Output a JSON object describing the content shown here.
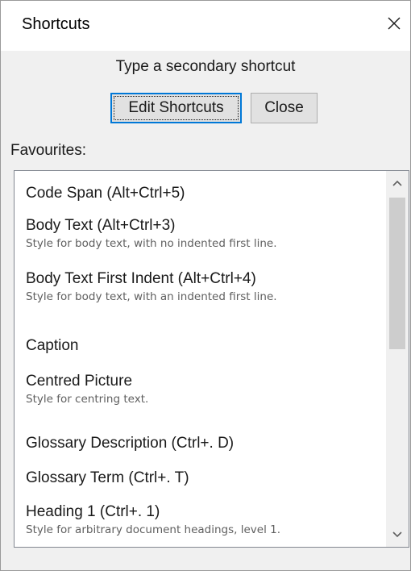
{
  "window": {
    "title": "Shortcuts",
    "close_icon": "close-icon"
  },
  "subtitle": "Type a secondary shortcut",
  "buttons": {
    "edit_shortcuts": "Edit Shortcuts",
    "close": "Close"
  },
  "favourites_label": "Favourites:",
  "favourites": [
    {
      "title": "Code Span (Alt+Ctrl+5)",
      "description": ""
    },
    {
      "title": "Body Text (Alt+Ctrl+3)",
      "description": "Style for body text, with no indented first line."
    },
    {
      "title": "Body Text First Indent (Alt+Ctrl+4)",
      "description": "Style for body text, with an indented first line."
    },
    {
      "title": "Caption",
      "description": ""
    },
    {
      "title": "Centred Picture",
      "description": "Style for centring text."
    },
    {
      "title": "Glossary Description (Ctrl+. D)",
      "description": ""
    },
    {
      "title": "Glossary Term (Ctrl+. T)",
      "description": ""
    },
    {
      "title": "Heading 1 (Ctrl+. 1)",
      "description": "Style for arbitrary document headings, level 1."
    }
  ],
  "scrollbar": {
    "up_icon": "chevron-up-icon",
    "down_icon": "chevron-down-icon"
  },
  "colors": {
    "window_bg": "#f0f0f0",
    "list_bg": "#ffffff",
    "focus_border": "#0078d7",
    "description_text": "#5f5f5f",
    "scroll_thumb": "#cdcdcd"
  }
}
